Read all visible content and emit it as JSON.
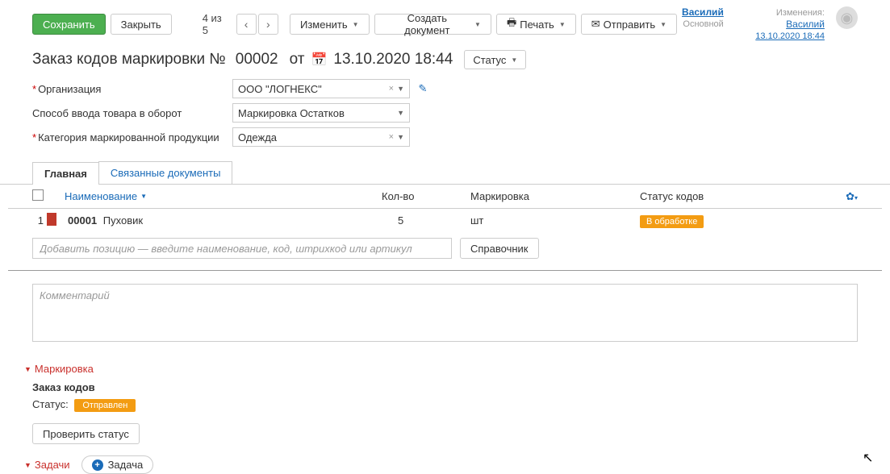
{
  "toolbar": {
    "save": "Сохранить",
    "close": "Закрыть",
    "pager": "4 из 5",
    "edit": "Изменить",
    "create_doc": "Создать документ",
    "print": "Печать",
    "send": "Отправить"
  },
  "user": {
    "name": "Василий",
    "profile": "Основной",
    "changes_label": "Изменения:",
    "changes_by": "Василий",
    "datetime": "13.10.2020 18:44"
  },
  "title": {
    "text": "Заказ кодов маркировки №",
    "number": "00002",
    "from": "от",
    "date": "13.10.2020 18:44",
    "status_btn": "Статус"
  },
  "form": {
    "org_label": "Организация",
    "org_value": "ООО \"ЛОГНЕКС\"",
    "method_label": "Способ ввода товара в оборот",
    "method_value": "Маркировка Остатков",
    "category_label": "Категория маркированной продукции",
    "category_value": "Одежда"
  },
  "tabs": {
    "main": "Главная",
    "linked": "Связанные документы"
  },
  "table": {
    "head": {
      "name": "Наименование",
      "qty": "Кол-во",
      "mark": "Маркировка",
      "status": "Статус кодов"
    },
    "row": {
      "idx": "1",
      "code": "00001",
      "name": "Пуховик",
      "qty": "5",
      "unit": "шт",
      "status": "В обработке"
    },
    "add_placeholder": "Добавить позицию — введите наименование, код, штрихкод или артикул",
    "ref_btn": "Справочник"
  },
  "comment_placeholder": "Комментарий",
  "marking": {
    "section": "Маркировка",
    "title": "Заказ кодов",
    "status_label": "Статус:",
    "status_value": "Отправлен",
    "check_btn": "Проверить статус"
  },
  "tasks": {
    "section": "Задачи",
    "add_btn": "Задача"
  }
}
